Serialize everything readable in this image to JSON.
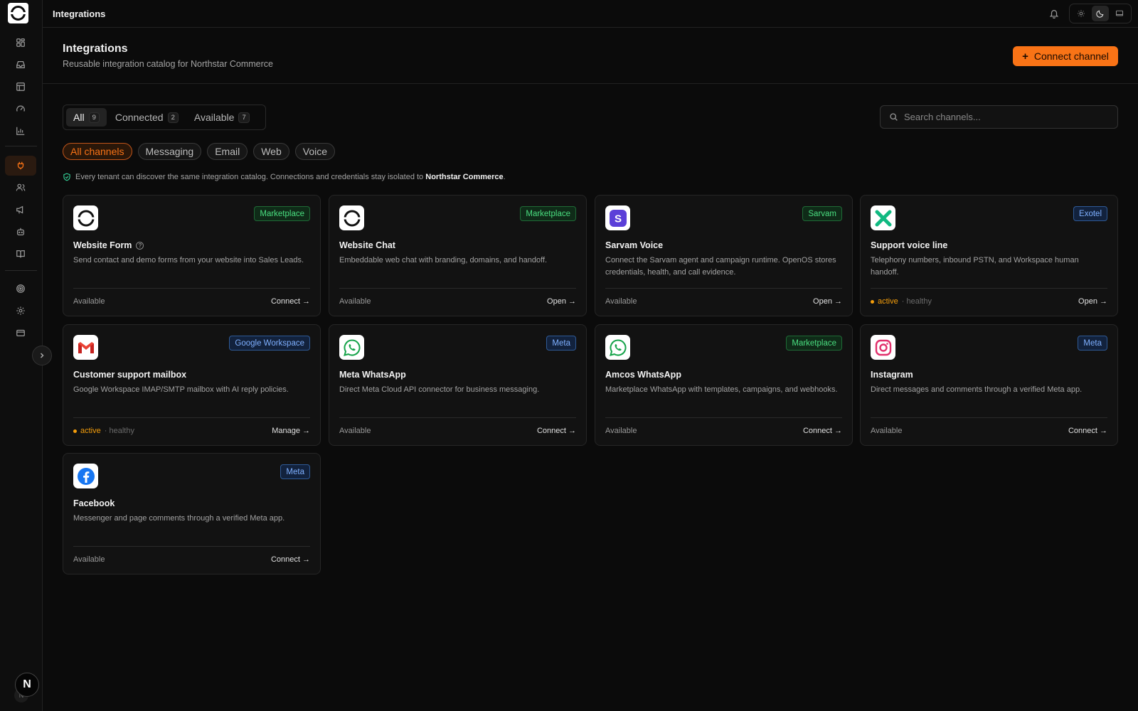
{
  "topbar": {
    "title": "Integrations"
  },
  "header": {
    "title": "Integrations",
    "subtitle": "Reusable integration catalog for Northstar Commerce",
    "connect_label": "Connect channel"
  },
  "tabs": [
    {
      "label": "All",
      "count": "9"
    },
    {
      "label": "Connected",
      "count": "2"
    },
    {
      "label": "Available",
      "count": "7"
    }
  ],
  "search": {
    "placeholder": "Search channels..."
  },
  "chips": [
    "All channels",
    "Messaging",
    "Email",
    "Web",
    "Voice"
  ],
  "notice": {
    "text": "Every tenant can discover the same integration catalog. Connections and credentials stay isolated to",
    "tenant": "Northstar Commerce",
    "end": "."
  },
  "avatar": {
    "initial": "N"
  },
  "colors": {
    "accent": "#f97316",
    "success": "#4ade80",
    "info": "#7fb0ff",
    "warning": "#f59e0b"
  },
  "cards": [
    {
      "title": "Website Form",
      "desc": "Send contact and demo forms from your website into Sales Leads.",
      "badge": "Marketplace",
      "status": "Available",
      "action": "Connect →",
      "icon": "northstar-logo-icon"
    },
    {
      "title": "Website Chat",
      "desc": "Embeddable web chat with branding, domains, and handoff.",
      "badge": "Marketplace",
      "status": "Available",
      "action": "Open →",
      "icon": "northstar-logo-icon"
    },
    {
      "title": "Sarvam Voice",
      "desc": "Connect the Sarvam agent and campaign runtime. OpenOS stores credentials, health, and call evidence.",
      "badge": "Sarvam",
      "status": "Available",
      "action": "Open →",
      "icon": "sarvam-icon"
    },
    {
      "title": "Support voice line",
      "desc": "Telephony numbers, inbound PSTN, and Workspace human handoff.",
      "badge": "Exotel",
      "status": "active",
      "health": "· healthy",
      "action": "Open →",
      "icon": "exotel-icon"
    },
    {
      "title": "Customer support mailbox",
      "desc": "Google Workspace IMAP/SMTP mailbox with AI reply policies.",
      "badge": "Google Workspace",
      "status": "active",
      "health": "· healthy",
      "action": "Manage →",
      "icon": "gmail-icon"
    },
    {
      "title": "Meta WhatsApp",
      "desc": "Direct Meta Cloud API connector for business messaging.",
      "badge": "Meta",
      "status": "Available",
      "action": "Connect →",
      "icon": "whatsapp-icon"
    },
    {
      "title": "Amcos WhatsApp",
      "desc": "Marketplace WhatsApp with templates, campaigns, and webhooks.",
      "badge": "Marketplace",
      "status": "Available",
      "action": "Connect →",
      "icon": "whatsapp-icon"
    },
    {
      "title": "Instagram",
      "desc": "Direct messages and comments through a verified Meta app.",
      "badge": "Meta",
      "status": "Available",
      "action": "Connect →",
      "icon": "instagram-icon"
    },
    {
      "title": "Facebook",
      "desc": "Messenger and page comments through a verified Meta app.",
      "badge": "Meta",
      "status": "Available",
      "action": "Connect →",
      "icon": "facebook-icon"
    }
  ]
}
